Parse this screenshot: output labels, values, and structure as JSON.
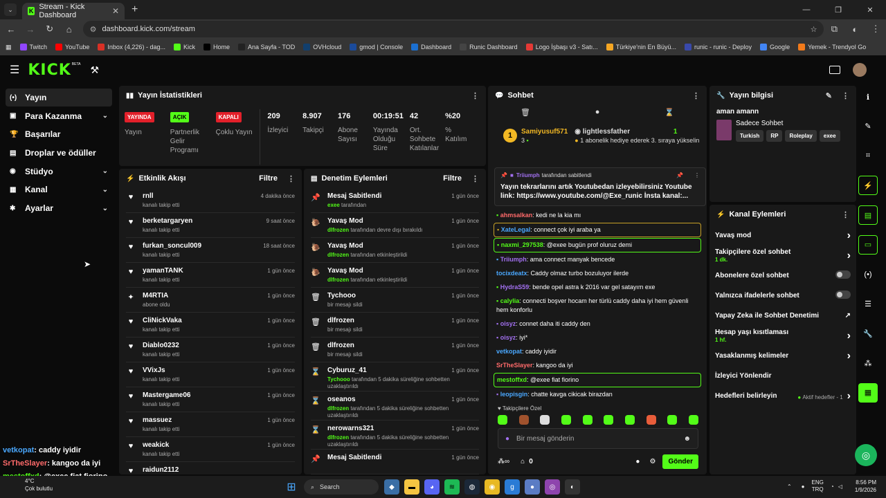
{
  "browser": {
    "tab_title": "Stream - Kick Dashboard",
    "url": "dashboard.kick.com/stream",
    "bookmarks": [
      {
        "label": "Twitch",
        "color": "#9146ff"
      },
      {
        "label": "YouTube",
        "color": "#ff0000"
      },
      {
        "label": "Inbox (4,226) - dag...",
        "color": "#d93025"
      },
      {
        "label": "Kick",
        "color": "#53fc18"
      },
      {
        "label": "Home",
        "color": "#000000"
      },
      {
        "label": "Ana Sayfa - TOD",
        "color": "#222222"
      },
      {
        "label": "OVHcloud",
        "color": "#123f6d"
      },
      {
        "label": "gmod | Console",
        "color": "#1b4b9b"
      },
      {
        "label": "Dashboard",
        "color": "#1b6fd0"
      },
      {
        "label": "Runic Dashboard",
        "color": "#444444"
      },
      {
        "label": "Logo İşbaşı v3 - Satı...",
        "color": "#e53935"
      },
      {
        "label": "Türkiye'nin En Büyü...",
        "color": "#f5a623"
      },
      {
        "label": "runic - runic - Deploy",
        "color": "#3949ab"
      },
      {
        "label": "Google",
        "color": "#4285f4"
      },
      {
        "label": "Yemek - Trendyol Go",
        "color": "#f27a1a"
      }
    ]
  },
  "header": {
    "logo": "KICK",
    "beta": "BETA"
  },
  "sidebar": {
    "items": [
      {
        "label": "Yayın",
        "icon": "broadcast-icon",
        "glyph": "(•)",
        "chevron": false
      },
      {
        "label": "Para Kazanma",
        "icon": "wallet-icon",
        "glyph": "▣",
        "chevron": true
      },
      {
        "label": "Başarılar",
        "icon": "trophy-icon",
        "glyph": "🏆",
        "chevron": false
      },
      {
        "label": "Droplar ve ödüller",
        "icon": "gift-icon",
        "glyph": "▤",
        "chevron": false
      },
      {
        "label": "Stüdyo",
        "icon": "studio-icon",
        "glyph": "◉",
        "chevron": true
      },
      {
        "label": "Kanal",
        "icon": "channel-icon",
        "glyph": "▦",
        "chevron": true
      },
      {
        "label": "Ayarlar",
        "icon": "settings-icon",
        "glyph": "✱",
        "chevron": true
      }
    ]
  },
  "overlay_chat": [
    {
      "user": "vetkopat",
      "color": "#4aa8ff",
      "text": ": caddy iyidir"
    },
    {
      "user": "SrTheSlayer",
      "color": "#ff6a6a",
      "text": ": kangoo da iyi"
    },
    {
      "user": "mestoffxd",
      "color": "#53fc18",
      "text": ": @exee fiat fiorino"
    }
  ],
  "stats": {
    "title": "Yayın İstatistikleri",
    "badges": [
      {
        "badge": "YAYINDA",
        "bg": "#e3202a",
        "fg": "#ffffff",
        "label": "Yayın"
      },
      {
        "badge": "AÇIK",
        "bg": "#53fc18",
        "fg": "#000000",
        "label": "Partnerlik Gelir Programı"
      },
      {
        "badge": "KAPALI",
        "bg": "#e3202a",
        "fg": "#ffffff",
        "label": "Çoklu Yayın"
      }
    ],
    "numbers": [
      {
        "value": "209",
        "label": "İzleyici"
      },
      {
        "value": "8.907",
        "label": "Takipçi"
      },
      {
        "value": "176",
        "label": "Abone Sayısı"
      },
      {
        "value": "00:19:51",
        "label": "Yayında Olduğu Süre"
      },
      {
        "value": "42",
        "label": "Ort. Sohbete Katılanlar"
      },
      {
        "value": "%20",
        "label": "% Katılım"
      }
    ]
  },
  "activity": {
    "title": "Etkinlik Akışı",
    "filter": "Filtre",
    "items": [
      {
        "icon": "heart-icon",
        "glyph": "♥",
        "name": "rnll",
        "sub": "kanalı takip etti",
        "time": "4 dakika önce"
      },
      {
        "icon": "heart-icon",
        "glyph": "♥",
        "name": "berketargaryen",
        "sub": "kanalı takip etti",
        "time": "9 saat önce"
      },
      {
        "icon": "heart-icon",
        "glyph": "♥",
        "name": "furkan_soncul009",
        "sub": "kanalı takip etti",
        "time": "18 saat önce"
      },
      {
        "icon": "heart-icon",
        "glyph": "♥",
        "name": "yamanTANK",
        "sub": "kanalı takip etti",
        "time": "1 gün önce"
      },
      {
        "icon": "sparkle-icon",
        "glyph": "✦",
        "name": "M4RTIA",
        "sub": "abone oldu",
        "time": "1 gün önce"
      },
      {
        "icon": "heart-icon",
        "glyph": "♥",
        "name": "CliNickVaka",
        "sub": "kanalı takip etti",
        "time": "1 gün önce"
      },
      {
        "icon": "heart-icon",
        "glyph": "♥",
        "name": "Diablo0232",
        "sub": "kanalı takip etti",
        "time": "1 gün önce"
      },
      {
        "icon": "heart-icon",
        "glyph": "♥",
        "name": "VVixJs",
        "sub": "kanalı takip etti",
        "time": "1 gün önce"
      },
      {
        "icon": "heart-icon",
        "glyph": "♥",
        "name": "Mastergame06",
        "sub": "kanalı takip etti",
        "time": "1 gün önce"
      },
      {
        "icon": "heart-icon",
        "glyph": "♥",
        "name": "massuez",
        "sub": "kanalı takip etti",
        "time": "1 gün önce"
      },
      {
        "icon": "heart-icon",
        "glyph": "♥",
        "name": "weakick",
        "sub": "kanalı takip etti",
        "time": "1 gün önce"
      },
      {
        "icon": "heart-icon",
        "glyph": "♥",
        "name": "raidun2112",
        "sub": "",
        "time": ""
      }
    ]
  },
  "moderation": {
    "title": "Denetim Eylemleri",
    "filter": "Filtre",
    "items": [
      {
        "icon": "pin-icon",
        "glyph": "📌",
        "name": "Mesaj Sabitlendi",
        "actor": "exee",
        "sub": "tarafından",
        "time": "1 gün önce"
      },
      {
        "icon": "snail-icon",
        "glyph": "🐌",
        "name": "Yavaş Mod",
        "actor": "dlfrozen",
        "sub": "tarafından devre dışı bırakıldı",
        "time": "1 gün önce"
      },
      {
        "icon": "snail-icon",
        "glyph": "🐌",
        "name": "Yavaş Mod",
        "actor": "dlfrozen",
        "sub": "tarafından etkinleştirildi",
        "time": "1 gün önce"
      },
      {
        "icon": "snail-icon",
        "glyph": "🐌",
        "name": "Yavaş Mod",
        "actor": "dlfrozen",
        "sub": "tarafından etkinleştirildi",
        "time": "1 gün önce"
      },
      {
        "icon": "trash-icon",
        "glyph": "🗑",
        "name": "Tychooo",
        "actor": "",
        "sub": "bir mesajı sildi",
        "time": "1 gün önce"
      },
      {
        "icon": "trash-icon",
        "glyph": "🗑",
        "name": "dlfrozen",
        "actor": "",
        "sub": "bir mesajı sildi",
        "time": "1 gün önce"
      },
      {
        "icon": "trash-icon",
        "glyph": "🗑",
        "name": "dlfrozen",
        "actor": "",
        "sub": "bir mesajı sildi",
        "time": "1 gün önce"
      },
      {
        "icon": "hourglass-icon",
        "glyph": "⌛",
        "name": "Cyburuz_41",
        "actor": "Tychooo",
        "sub": "tarafından 5 dakika süreliğine sohbetten uzaklaştırıldı",
        "time": "1 gün önce"
      },
      {
        "icon": "hourglass-icon",
        "glyph": "⌛",
        "name": "oseanos",
        "actor": "dlfrozen",
        "sub": "tarafından 5 dakika süreliğine sohbetten uzaklaştırıldı",
        "time": "1 gün önce"
      },
      {
        "icon": "hourglass-icon",
        "glyph": "⌛",
        "name": "nerowarns321",
        "actor": "dlfrozen",
        "sub": "tarafından 5 dakika süreliğine sohbetten uzaklaştırıldı",
        "time": "1 gün önce"
      },
      {
        "icon": "pin-icon",
        "glyph": "📌",
        "name": "Mesaj Sabitlendi",
        "actor": "",
        "sub": "",
        "time": "1 gün önce"
      }
    ]
  },
  "chat": {
    "title": "Sohbet",
    "gift": {
      "rank": "1",
      "user1": "Samiyusuf571",
      "count1": "3",
      "user2": "lightlessfather",
      "count2": "1",
      "desc": "1 abonelik hediye ederek 3. sıraya yükselin"
    },
    "pinned": {
      "by": "Triiumph",
      "by_suffix": "tarafından sabitlendi",
      "text": "Yayın tekrarlarını artık Youtubedan izleyebilirsiniz Youtube link: https://www.youtube.com/@Exe_runic İnsta kanal:..."
    },
    "messages": [
      {
        "user": "ahmsalkan",
        "color": "#ff6a6a",
        "text": ": kedi ne la kia mı",
        "style": ""
      },
      {
        "user": "XateLegal",
        "color": "#4aa8ff",
        "text": ": connect çok iyi araba ya",
        "style": "gold"
      },
      {
        "user": "naxmi_297538",
        "color": "#53fc18",
        "text": ": @exee bugün prof oluruz demi",
        "style": "hl"
      },
      {
        "user": "Triiumph",
        "color": "#a270f0",
        "text": ": ama connect manyak bencede",
        "style": ""
      },
      {
        "user": "tocixdeatx",
        "color": "#4aa8ff",
        "text": ": Caddy olmaz turbo bozuluyor ilerde",
        "style": ""
      },
      {
        "user": "HydraS59",
        "color": "#a270f0",
        "text": ": bende opel astra k 2016 var gel satayım exe",
        "style": ""
      },
      {
        "user": "calylia",
        "color": "#53fc18",
        "text": ": connecti boşver hocam her türlü caddy daha iyi hem güvenli hem konforlu",
        "style": ""
      },
      {
        "user": "oisyz",
        "color": "#a270f0",
        "text": ": connet daha iti caddy den",
        "style": ""
      },
      {
        "user": "oisyz",
        "color": "#a270f0",
        "text": ": iyi*",
        "style": ""
      },
      {
        "user": "vetkopat",
        "color": "#4aa8ff",
        "text": ": caddy iyidir",
        "style": ""
      },
      {
        "user": "SrTheSlayer",
        "color": "#ff6a6a",
        "text": ": kangoo da iyi",
        "style": ""
      },
      {
        "user": "mestoffxd",
        "color": "#53fc18",
        "text": ": @exee fiat fiorino",
        "style": "hl"
      },
      {
        "user": "leopisgin",
        "color": "#4aa8ff",
        "text": ": chatte kavga cikicak birazdan",
        "style": ""
      }
    ],
    "emote_header": "Takipçilere Özel",
    "input_placeholder": "Bir mesaj gönderin",
    "count": "0",
    "send": "Gönder"
  },
  "stream_info": {
    "title": "Yayın bilgisi",
    "stream_title": "aman amann",
    "category": "Sadece Sohbet",
    "tags": [
      "Turkish",
      "RP",
      "Roleplay",
      "exee"
    ]
  },
  "channel_actions": {
    "title": "Kanal Eylemleri",
    "items": [
      {
        "label": "Yavaş mod",
        "sub": "",
        "control": "chevron",
        "extra": ""
      },
      {
        "label": "Takipçilere özel sohbet",
        "sub": "1 dk.",
        "control": "chevron",
        "extra": ""
      },
      {
        "label": "Abonelere özel sohbet",
        "sub": "",
        "control": "toggle",
        "extra": ""
      },
      {
        "label": "Yalnızca ifadelerle sohbet",
        "sub": "",
        "control": "toggle",
        "extra": ""
      },
      {
        "label": "Yapay Zeka ile Sohbet Denetimi",
        "sub": "",
        "control": "external",
        "extra": ""
      },
      {
        "label": "Hesap yaşı kısıtlaması",
        "sub": "1 hf.",
        "control": "chevron",
        "extra": ""
      },
      {
        "label": "Yasaklanmış kelimeler",
        "sub": "",
        "control": "chevron",
        "extra": ""
      },
      {
        "label": "İzleyici Yönlendir",
        "sub": "",
        "control": "none",
        "extra": ""
      },
      {
        "label": "Hedefleri belirleyin",
        "sub": "",
        "control": "chevron",
        "extra": "Aktif hedefler - 1"
      }
    ]
  },
  "taskbar": {
    "weather_temp": "4°C",
    "weather_desc": "Çok bulutlu",
    "search": "Search",
    "lang1": "ENG",
    "lang2": "TRQ",
    "time": "8:56 PM",
    "date": "1/9/2026"
  }
}
